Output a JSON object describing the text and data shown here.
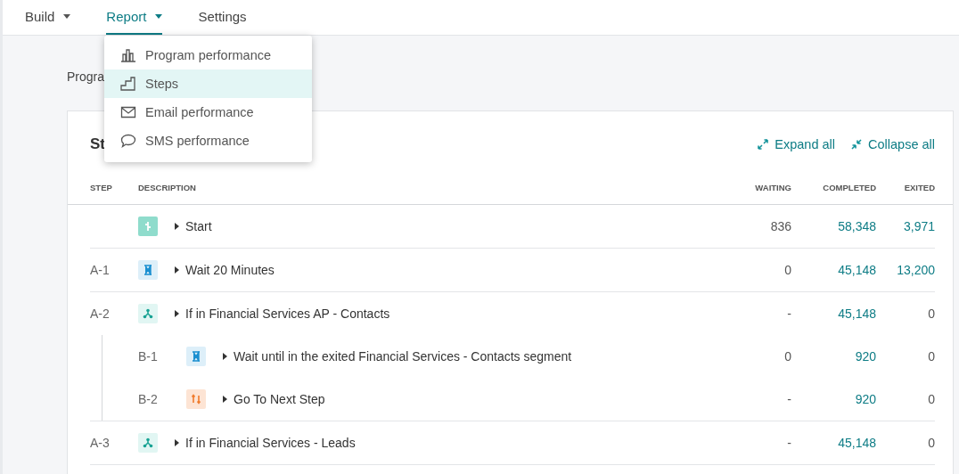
{
  "nav": {
    "tabs": [
      {
        "label": "Build",
        "selected": false,
        "has_menu": true
      },
      {
        "label": "Report",
        "selected": true,
        "has_menu": true
      },
      {
        "label": "Settings",
        "selected": false,
        "has_menu": false
      }
    ]
  },
  "menu": {
    "items": [
      {
        "label": "Program performance",
        "kind": "chart",
        "selected": false
      },
      {
        "label": "Steps",
        "kind": "steps",
        "selected": true
      },
      {
        "label": "Email performance",
        "kind": "email",
        "selected": false
      },
      {
        "label": "SMS performance",
        "kind": "sms",
        "selected": false
      }
    ]
  },
  "page_label": "Progra",
  "card": {
    "title": "St",
    "actions": [
      {
        "label": "Expand all",
        "kind": "expand"
      },
      {
        "label": "Collapse all",
        "kind": "collapse"
      }
    ],
    "columns": [
      "STEP",
      "DESCRIPTION",
      "WAITING",
      "COMPLETED",
      "EXITED"
    ],
    "rows": [
      {
        "kind": "start",
        "description": "Start",
        "waiting": "836",
        "completed": "58,348",
        "exited": "3,971",
        "exited_link": true
      },
      {
        "step": "A-1",
        "kind": "wait",
        "description": "Wait 20 Minutes",
        "waiting": "0",
        "completed": "45,148",
        "exited": "13,200",
        "exited_link": true
      },
      {
        "step": "A-2",
        "kind": "branch",
        "description": "If in Financial Services AP - Contacts",
        "waiting": "-",
        "completed": "45,148",
        "exited": "0",
        "exited_link": false,
        "children": [
          {
            "step": "B-1",
            "kind": "wait",
            "description": "Wait until in the exited Financial Services - Contacts segment",
            "waiting": "0",
            "completed": "920",
            "exited": "0",
            "exited_link": false
          },
          {
            "step": "B-2",
            "kind": "goto",
            "description": "Go To Next Step",
            "waiting": "-",
            "completed": "920",
            "exited": "0",
            "exited_link": false
          }
        ]
      },
      {
        "step": "A-3",
        "kind": "branch",
        "description": "If in Financial Services - Leads",
        "waiting": "-",
        "completed": "45,148",
        "exited": "0",
        "exited_link": false
      }
    ]
  }
}
